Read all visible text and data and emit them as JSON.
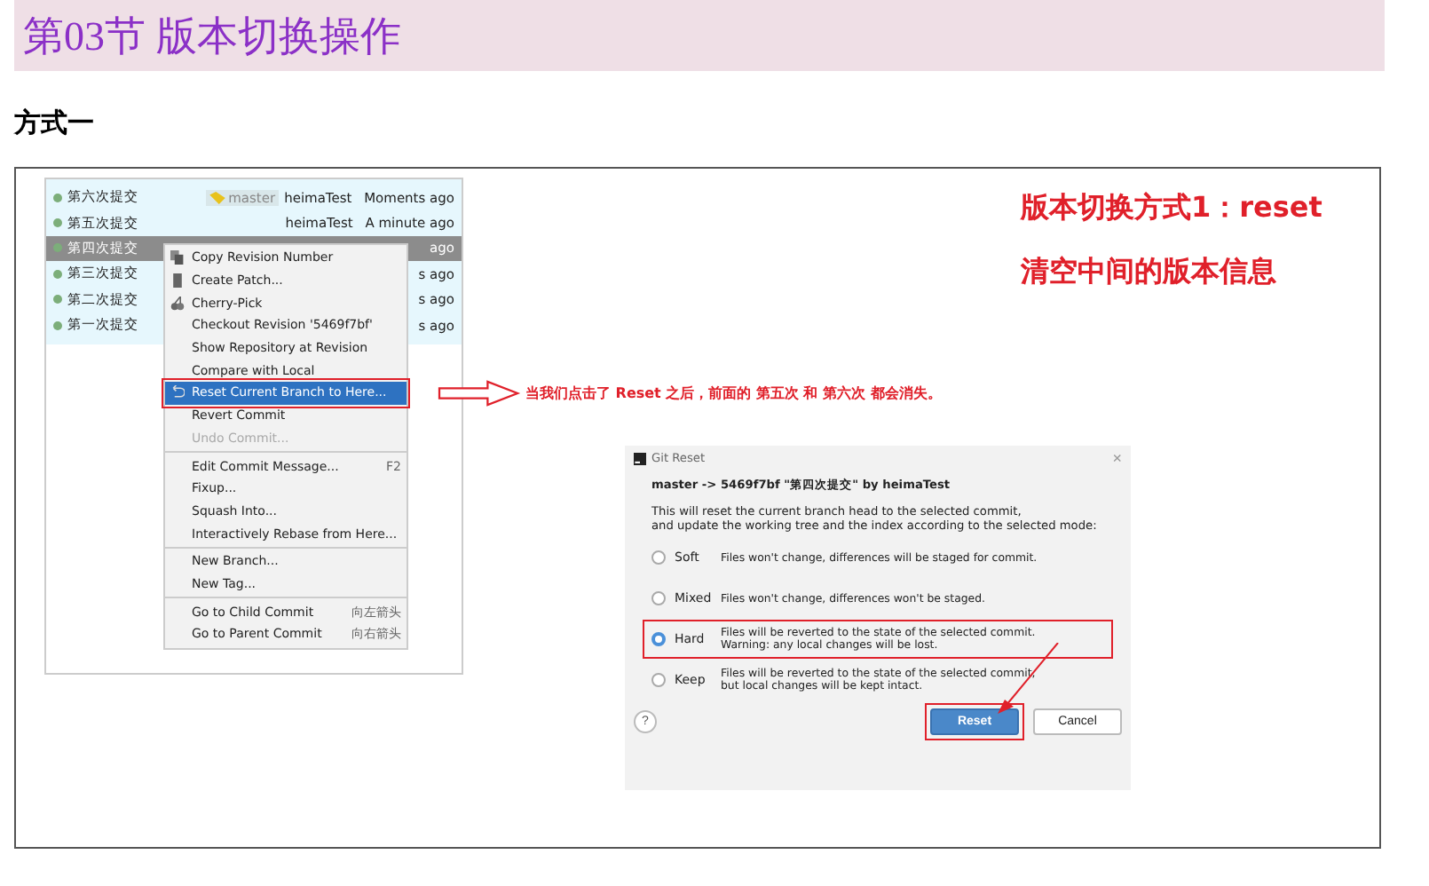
{
  "heading": {
    "title": "第03节 版本切换操作"
  },
  "subheading": "方式一",
  "log": {
    "rows": [
      {
        "message": "第六次提交",
        "branch": "master",
        "author": "heimaTest",
        "date": "Moments ago",
        "selected": false
      },
      {
        "message": "第五次提交",
        "author": "heimaTest",
        "date": "A minute ago",
        "selected": false
      },
      {
        "message": "第四次提交",
        "date": "ago",
        "selected": true
      },
      {
        "message": "第三次提交",
        "date": "s ago",
        "selected": false
      },
      {
        "message": "第二次提交",
        "date": "s ago",
        "selected": false
      },
      {
        "message": "第一次提交",
        "date": "s ago",
        "selected": false
      }
    ]
  },
  "context_menu": {
    "items": [
      {
        "kind": "item",
        "label": "Copy Revision Number",
        "disabled": false,
        "selected": false
      },
      {
        "kind": "item",
        "label": "Create Patch...",
        "disabled": false,
        "selected": false
      },
      {
        "kind": "item",
        "label": "Cherry-Pick",
        "disabled": false,
        "selected": false
      },
      {
        "kind": "item",
        "label": "Checkout Revision '5469f7bf'",
        "disabled": false,
        "selected": false
      },
      {
        "kind": "item",
        "label": "Show Repository at Revision",
        "disabled": false,
        "selected": false
      },
      {
        "kind": "item",
        "label": "Compare with Local",
        "disabled": false,
        "selected": false
      },
      {
        "kind": "item",
        "label": "Reset Current Branch to Here...",
        "disabled": false,
        "selected": true
      },
      {
        "kind": "item",
        "label": "Revert Commit",
        "disabled": false,
        "selected": false
      },
      {
        "kind": "item",
        "label": "Undo Commit...",
        "disabled": true,
        "selected": false
      },
      {
        "kind": "separator"
      },
      {
        "kind": "item",
        "label": "Edit Commit Message...",
        "shortcut": "F2",
        "disabled": false,
        "selected": false
      },
      {
        "kind": "item",
        "label": "Fixup...",
        "disabled": false,
        "selected": false
      },
      {
        "kind": "item",
        "label": "Squash Into...",
        "disabled": false,
        "selected": false
      },
      {
        "kind": "item",
        "label": "Interactively Rebase from Here...",
        "disabled": false,
        "selected": false
      },
      {
        "kind": "separator"
      },
      {
        "kind": "item",
        "label": "New Branch...",
        "disabled": false,
        "selected": false
      },
      {
        "kind": "item",
        "label": "New Tag...",
        "disabled": false,
        "selected": false
      },
      {
        "kind": "separator"
      },
      {
        "kind": "item",
        "label": "Go to Child Commit",
        "shortcut": "向左箭头",
        "disabled": false,
        "selected": false
      },
      {
        "kind": "item",
        "label": "Go to Parent Commit",
        "shortcut": "向右箭头",
        "disabled": false,
        "selected": false
      }
    ]
  },
  "annotations": {
    "title_lines": [
      "版本切换方式1：reset",
      "清空中间的版本信息"
    ],
    "arrow_note": "当我们点击了 Reset 之后，前面的 第五次 和 第六次 都会消失。"
  },
  "dialog": {
    "title": "Git Reset",
    "close": "×",
    "header": "master -> 5469f7bf \"第四次提交\" by heimaTest",
    "description": [
      "This will reset the current branch head to the selected commit,",
      "and update the working tree and the index according to the selected mode:"
    ],
    "options": [
      {
        "label": "Soft",
        "description": [
          "Files won't change, differences will be staged for commit."
        ],
        "selected": false
      },
      {
        "label": "Mixed",
        "description": [
          "Files won't change, differences won't be staged."
        ],
        "selected": false
      },
      {
        "label": "Hard",
        "description": [
          "Files will be reverted to the state of the selected commit.",
          "Warning: any local changes will be lost."
        ],
        "selected": true
      },
      {
        "label": "Keep",
        "description": [
          "Files will be reverted to the state of the selected commit,",
          "but local changes will be kept intact."
        ],
        "selected": false
      }
    ],
    "help": "?",
    "buttons": [
      {
        "label": "Reset",
        "kind": "primary"
      },
      {
        "label": "Cancel",
        "kind": "secondary"
      }
    ]
  }
}
